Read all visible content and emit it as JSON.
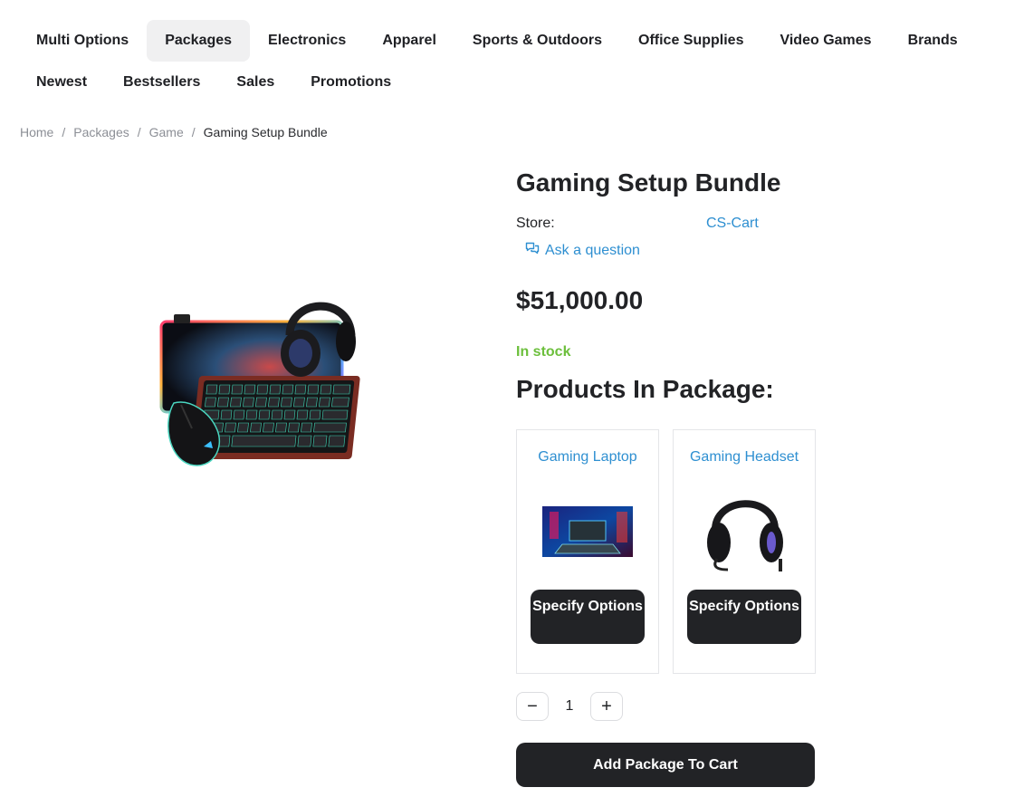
{
  "nav": {
    "row1": [
      "Multi Options",
      "Packages",
      "Electronics",
      "Apparel",
      "Sports & Outdoors",
      "Office Supplies",
      "Video Games",
      "Brands"
    ],
    "row2": [
      "Newest",
      "Bestsellers",
      "Sales",
      "Promotions"
    ],
    "active": "Packages"
  },
  "breadcrumb": {
    "items": [
      "Home",
      "Packages",
      "Game"
    ],
    "separator": "/",
    "current": "Gaming Setup Bundle"
  },
  "product": {
    "title": "Gaming Setup Bundle",
    "store_label": "Store:",
    "store_value": "CS-Cart",
    "ask_label": "Ask a question",
    "ask_icon": "chat-bubbles-icon",
    "price": "$51,000.00",
    "stock": "In stock",
    "image": "gaming-bundle-image"
  },
  "package": {
    "heading": "Products In Package:",
    "items": [
      {
        "name": "Gaming Laptop",
        "image": "laptop-image",
        "button": "Specify Options"
      },
      {
        "name": "Gaming Headset",
        "image": "headset-image",
        "button": "Specify Options"
      }
    ]
  },
  "quantity": {
    "minus": "−",
    "value": "1",
    "plus": "+"
  },
  "cart": {
    "add_label": "Add Package To Cart"
  },
  "colors": {
    "link": "#2e8fd1",
    "stock": "#6cbf3c",
    "dark": "#222326"
  }
}
